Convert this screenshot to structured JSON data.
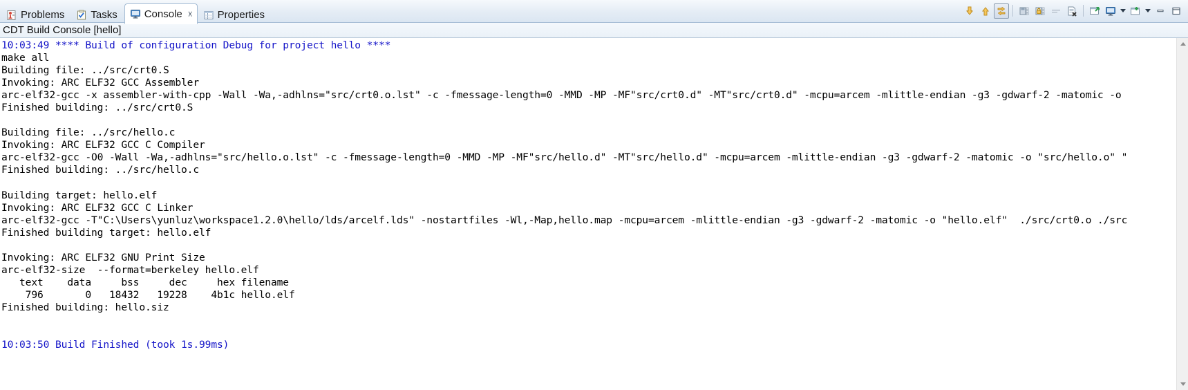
{
  "window": {
    "view_title": "CDT Build Console [hello]"
  },
  "tabs": [
    {
      "label": "Problems",
      "icon": "problems-icon",
      "active": false,
      "closeable": false
    },
    {
      "label": "Tasks",
      "icon": "tasks-icon",
      "active": false,
      "closeable": false
    },
    {
      "label": "Console",
      "icon": "console-icon",
      "active": true,
      "closeable": true,
      "close_glyph": "☓"
    },
    {
      "label": "Properties",
      "icon": "properties-icon",
      "active": false,
      "closeable": false
    }
  ],
  "toolbar": {
    "buttons": [
      {
        "name": "scroll-lock-down-icon",
        "title": "Scroll Lock",
        "pressed": false
      },
      {
        "name": "scroll-up-icon",
        "title": "Scroll Up",
        "pressed": false
      },
      {
        "name": "pin-console-icon",
        "title": "Pin Console",
        "pressed": true
      },
      {
        "name": "save-console-icon",
        "title": "Save Console",
        "pressed": false
      },
      {
        "name": "lock-console-icon",
        "title": "Lock Console",
        "pressed": false
      },
      {
        "name": "word-wrap-icon",
        "title": "Word Wrap",
        "pressed": false
      },
      {
        "name": "clear-console-icon",
        "title": "Clear Console",
        "pressed": false
      },
      {
        "name": "open-console-icon",
        "title": "Open Console",
        "pressed": false
      },
      {
        "name": "display-console-icon",
        "title": "Display Selected Console",
        "pressed": false
      },
      {
        "name": "display-console-dropdown-icon",
        "title": "Display Console Menu",
        "pressed": false
      },
      {
        "name": "new-console-icon",
        "title": "New Console View",
        "pressed": false
      },
      {
        "name": "view-menu-dropdown-icon",
        "title": "View Menu",
        "pressed": false
      },
      {
        "name": "minimize-icon",
        "title": "Minimize",
        "pressed": false
      },
      {
        "name": "maximize-icon",
        "title": "Maximize",
        "pressed": false
      }
    ]
  },
  "console": {
    "lines": [
      {
        "text": "10:03:49 **** Build of configuration Debug for project hello ****",
        "style": "blue"
      },
      {
        "text": "make all",
        "style": "plain"
      },
      {
        "text": "Building file: ../src/crt0.S",
        "style": "plain"
      },
      {
        "text": "Invoking: ARC ELF32 GCC Assembler",
        "style": "plain"
      },
      {
        "text": "arc-elf32-gcc -x assembler-with-cpp -Wall -Wa,-adhlns=\"src/crt0.o.lst\" -c -fmessage-length=0 -MMD -MP -MF\"src/crt0.d\" -MT\"src/crt0.d\" -mcpu=arcem -mlittle-endian -g3 -gdwarf-2 -matomic -o",
        "style": "plain"
      },
      {
        "text": "Finished building: ../src/crt0.S",
        "style": "plain"
      },
      {
        "text": "",
        "style": "plain"
      },
      {
        "text": "Building file: ../src/hello.c",
        "style": "plain"
      },
      {
        "text": "Invoking: ARC ELF32 GCC C Compiler",
        "style": "plain"
      },
      {
        "text": "arc-elf32-gcc -O0 -Wall -Wa,-adhlns=\"src/hello.o.lst\" -c -fmessage-length=0 -MMD -MP -MF\"src/hello.d\" -MT\"src/hello.d\" -mcpu=arcem -mlittle-endian -g3 -gdwarf-2 -matomic -o \"src/hello.o\" \"",
        "style": "plain"
      },
      {
        "text": "Finished building: ../src/hello.c",
        "style": "plain"
      },
      {
        "text": "",
        "style": "plain"
      },
      {
        "text": "Building target: hello.elf",
        "style": "plain"
      },
      {
        "text": "Invoking: ARC ELF32 GCC C Linker",
        "style": "plain"
      },
      {
        "text": "arc-elf32-gcc -T\"C:\\Users\\yunluz\\workspace1.2.0\\hello/lds/arcelf.lds\" -nostartfiles -Wl,-Map,hello.map -mcpu=arcem -mlittle-endian -g3 -gdwarf-2 -matomic -o \"hello.elf\"  ./src/crt0.o ./src",
        "style": "plain"
      },
      {
        "text": "Finished building target: hello.elf",
        "style": "plain"
      },
      {
        "text": "",
        "style": "plain"
      },
      {
        "text": "Invoking: ARC ELF32 GNU Print Size",
        "style": "plain"
      },
      {
        "text": "arc-elf32-size  --format=berkeley hello.elf",
        "style": "plain"
      },
      {
        "text": "   text    data     bss     dec     hex filename",
        "style": "plain"
      },
      {
        "text": "    796       0   18432   19228    4b1c hello.elf",
        "style": "plain"
      },
      {
        "text": "Finished building: hello.siz",
        "style": "plain"
      },
      {
        "text": "",
        "style": "plain"
      },
      {
        "text": "",
        "style": "plain"
      },
      {
        "text": "10:03:50 Build Finished (took 1s.99ms)",
        "style": "blue"
      }
    ]
  },
  "scrollbar": {
    "up_glyph": "▲",
    "down_glyph": "▼"
  },
  "colors": {
    "console_text": "#000000",
    "build_message": "#1414c8",
    "tab_active_bg": "#ffffff",
    "tabbar_border": "#a5bcd4"
  }
}
